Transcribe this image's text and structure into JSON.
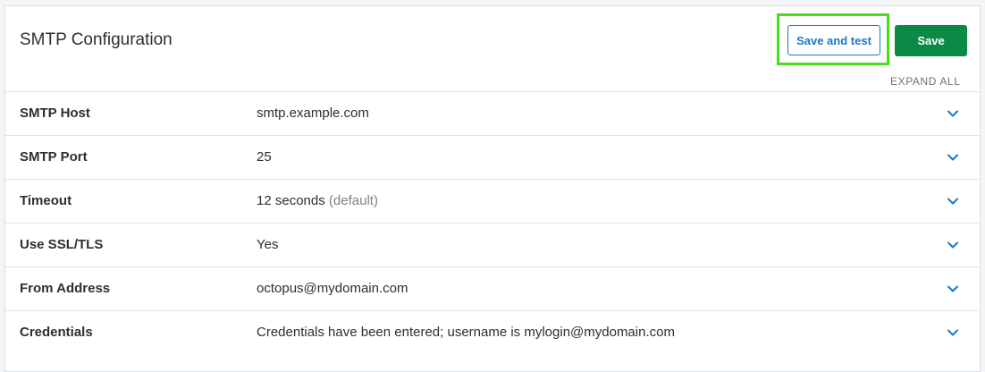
{
  "header": {
    "title": "SMTP Configuration",
    "save_and_test_label": "Save and test",
    "save_label": "Save",
    "expand_all_label": "EXPAND ALL"
  },
  "colors": {
    "primary_button": "#0b8a45",
    "link_blue": "#1a77c9",
    "highlight": "#44e01a"
  },
  "rows": [
    {
      "label": "SMTP Host",
      "value": "smtp.example.com",
      "hint": "",
      "icon": "chevron-down-icon"
    },
    {
      "label": "SMTP Port",
      "value": "25",
      "hint": "",
      "icon": "chevron-down-icon"
    },
    {
      "label": "Timeout",
      "value": "12 seconds",
      "hint": "(default)",
      "icon": "chevron-down-icon"
    },
    {
      "label": "Use SSL/TLS",
      "value": "Yes",
      "hint": "",
      "icon": "chevron-down-icon"
    },
    {
      "label": "From Address",
      "value": "octopus@mydomain.com",
      "hint": "",
      "icon": "chevron-down-icon"
    },
    {
      "label": "Credentials",
      "value": "Credentials have been entered; username is mylogin@mydomain.com",
      "hint": "",
      "icon": "chevron-down-icon"
    }
  ]
}
